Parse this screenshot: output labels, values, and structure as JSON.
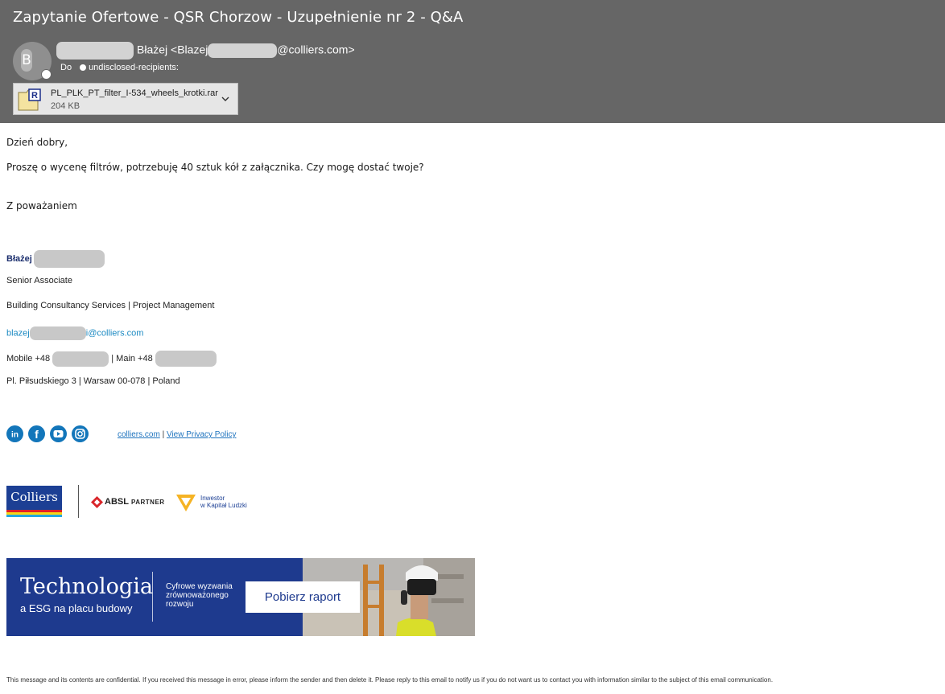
{
  "email": {
    "subject": "Zapytanie Ofertowe - QSR Chorzow - Uzupełnienie nr 2 - Q&A",
    "avatar_letter": "B",
    "sender_name": "Błażej",
    "sender_email_prefix": "<Blazej",
    "sender_email_suffix": "@colliers.com>",
    "to_label": "Do",
    "to_value": "undisclosed-recipients:"
  },
  "attachment": {
    "filename": "PL_PLK_PT_filter_I-534_wheels_krotki.rar",
    "size": "204 KB",
    "icon": "rar-archive-icon"
  },
  "body": {
    "greeting": "Dzień dobry,",
    "message": "Proszę o wycenę filtrów, potrzebuję 40 sztuk kół z załącznika. Czy mogę dostać twoje?",
    "closing": "Z poważaniem"
  },
  "signature": {
    "name": "Błażej",
    "title": "Senior Associate",
    "department": "Building Consultancy Services | Project Management",
    "email_prefix": "blazej",
    "email_suffix": "i@colliers.com",
    "mobile_label": "Mobile +48",
    "main_label": "| Main +48",
    "address": "Pl. Piłsudskiego 3 | Warsaw 00-078 | Poland",
    "social_icons": [
      "linkedin-icon",
      "facebook-icon",
      "youtube-icon",
      "instagram-icon"
    ],
    "website_link": "colliers.com",
    "link_separator": "|",
    "privacy_link": "View Privacy Policy"
  },
  "logos": {
    "colliers": "Colliers",
    "absl_brand": "ABSL",
    "absl_partner": "PARTNER",
    "investor_line1": "Inwestor",
    "investor_line2": "w Kapitał Ludzki"
  },
  "banner": {
    "headline": "Technologia",
    "subline": "a ESG na placu budowy",
    "description_line1": "Cyfrowe wyzwania",
    "description_line2": "zrównoważonego",
    "description_line3": "rozwoju",
    "cta": "Pobierz raport"
  },
  "footer": {
    "disclaimer": "This message and its contents are confidential. If you received this message in error, please inform the sender and then delete it. Please reply to this email to notify us if you do not want us to contact you with information similar to the subject of this email communication."
  },
  "colors": {
    "header_bg": "#666666",
    "brand_blue": "#1c3f94",
    "link_blue": "#1e8bc3",
    "social_blue": "#1376ba"
  }
}
